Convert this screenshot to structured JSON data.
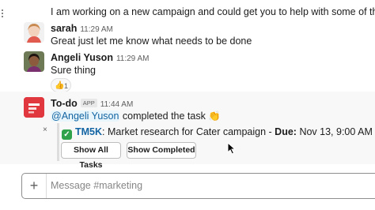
{
  "previous_message": {
    "text": "I am working on a new campaign and could get you to help with some of the research"
  },
  "messages": [
    {
      "author": "sarah",
      "time": "11:29 AM",
      "text": "Great just let me know what needs to be done"
    },
    {
      "author": "Angeli Yuson",
      "time": "11:29 AM",
      "text": "Sure thing",
      "reaction": {
        "emoji": "👍",
        "count": "1"
      }
    }
  ],
  "todo": {
    "author": "To-do",
    "badge": "APP",
    "time": "11:44 AM",
    "mention": "@Angeli Yuson",
    "action_text": "completed the task",
    "action_emoji": "👏",
    "task_id": "TM5K",
    "task_text": ": Market research for Cater campaign - ",
    "due_label": "Due:",
    "due_value": "Nov 13, 9:00 AM",
    "close_glyph": "×",
    "buttons": {
      "show_all": "Show All Tasks",
      "show_completed": "Show Completed"
    }
  },
  "composer": {
    "plus": "+",
    "placeholder": "Message #marketing"
  },
  "colors": {
    "link": "#1264a3",
    "check_green": "#31a24c",
    "todo_red": "#e0383e"
  },
  "icons": [
    "more-dots-icon",
    "check-icon",
    "close-icon",
    "plus-icon",
    "todo-app-icon"
  ]
}
